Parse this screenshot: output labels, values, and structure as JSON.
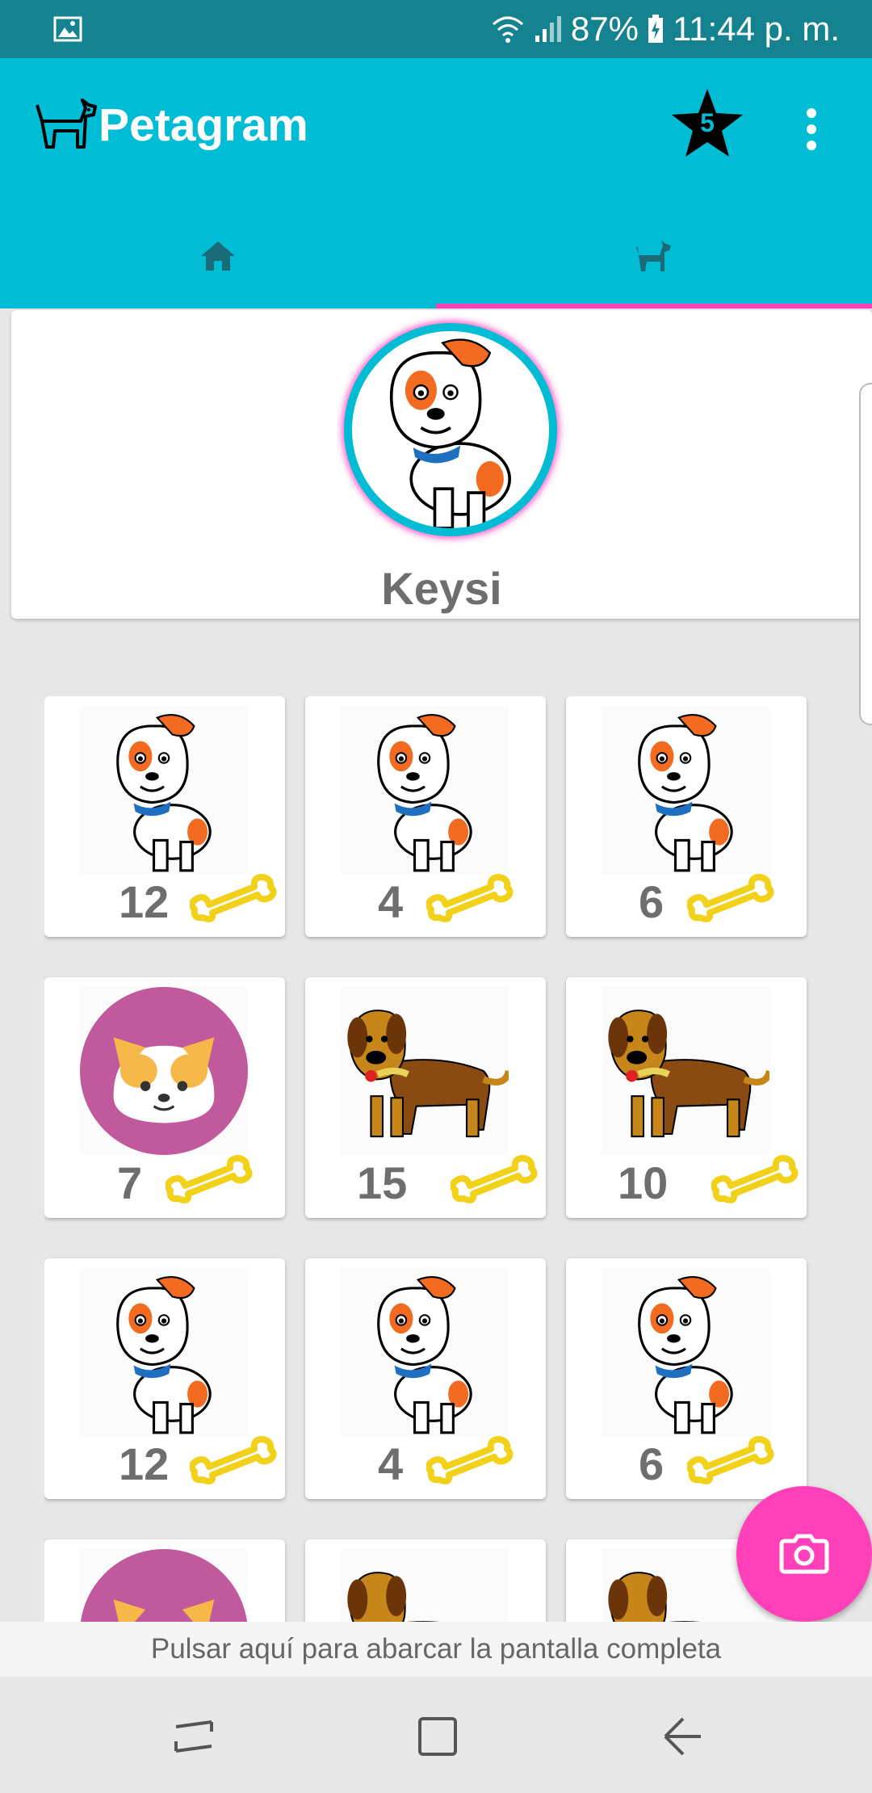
{
  "status_bar": {
    "battery": "87%",
    "time": "11:44 p. m.",
    "icons": [
      "image-icon",
      "wifi-icon",
      "signal-icon",
      "battery-charging-icon"
    ]
  },
  "app_bar": {
    "title": "Petagram",
    "favorites_count": "5",
    "icons": [
      "dog-logo-icon",
      "star-badge-icon",
      "overflow-menu-icon"
    ]
  },
  "tabs": [
    {
      "name": "home",
      "icon": "home-icon",
      "selected": false
    },
    {
      "name": "pets",
      "icon": "dog-icon",
      "selected": true
    }
  ],
  "profile": {
    "name": "Keysi"
  },
  "pets_grid": [
    {
      "likes": "12",
      "image": "spotted-puppy"
    },
    {
      "likes": "4",
      "image": "spotted-puppy"
    },
    {
      "likes": "6",
      "image": "spotted-puppy"
    },
    {
      "likes": "7",
      "image": "cat-face"
    },
    {
      "likes": "15",
      "image": "brown-dog"
    },
    {
      "likes": "10",
      "image": "brown-dog"
    },
    {
      "likes": "12",
      "image": "spotted-puppy"
    },
    {
      "likes": "4",
      "image": "spotted-puppy"
    },
    {
      "likes": "6",
      "image": "spotted-puppy"
    },
    {
      "likes": "",
      "image": "cat-face"
    },
    {
      "likes": "",
      "image": "brown-dog"
    },
    {
      "likes": "",
      "image": "brown-dog"
    }
  ],
  "fab": {
    "icon": "camera-icon"
  },
  "toast": {
    "text": "Pulsar aquí para abarcar la pantalla completa"
  },
  "nav_bar": {
    "icons": [
      "recent-apps-icon",
      "home-square-icon",
      "back-icon"
    ]
  },
  "colors": {
    "primary": "#00bcd4",
    "status_bar": "#14828f",
    "accent": "#ff40b8",
    "bone": "#f2d11b",
    "text_gray": "#6e6e6e"
  }
}
